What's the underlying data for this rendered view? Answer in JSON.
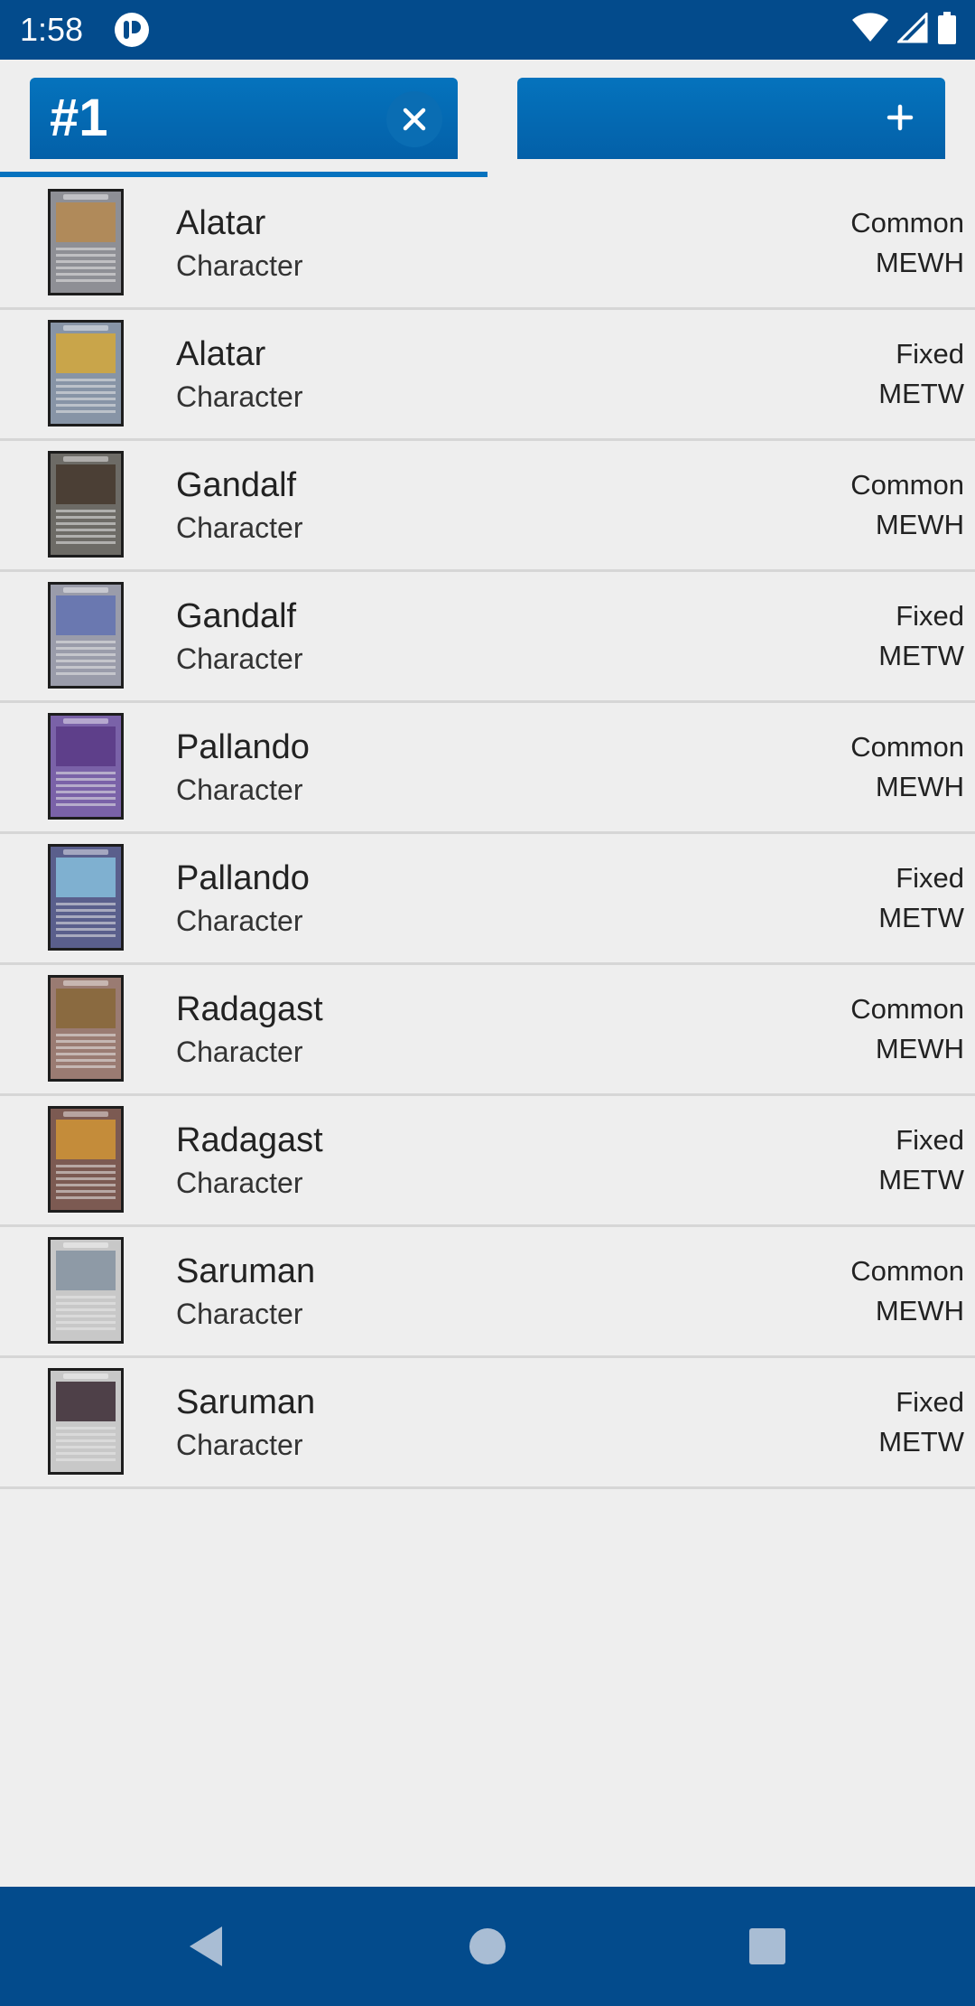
{
  "status_bar": {
    "time": "1:58",
    "icons": [
      "app-notification-icon",
      "wifi-icon",
      "cellular-signal-icon",
      "battery-icon"
    ]
  },
  "tabs": [
    {
      "label": "#1",
      "icon": "close-icon",
      "active": true
    },
    {
      "label": "",
      "icon": "plus-icon",
      "active": false
    }
  ],
  "cards": [
    {
      "name": "Alatar",
      "type": "Character",
      "rarity": "Common",
      "set": "MEWH",
      "art_color": "#b08a5a",
      "frame_color": "#8e8f95"
    },
    {
      "name": "Alatar",
      "type": "Character",
      "rarity": "Fixed",
      "set": "METW",
      "art_color": "#c9a54a",
      "frame_color": "#8794a6"
    },
    {
      "name": "Gandalf",
      "type": "Character",
      "rarity": "Common",
      "set": "MEWH",
      "art_color": "#4b3f35",
      "frame_color": "#6d6b66"
    },
    {
      "name": "Gandalf",
      "type": "Character",
      "rarity": "Fixed",
      "set": "METW",
      "art_color": "#6a78b0",
      "frame_color": "#9a9caa"
    },
    {
      "name": "Pallando",
      "type": "Character",
      "rarity": "Common",
      "set": "MEWH",
      "art_color": "#5e3f8a",
      "frame_color": "#7a62a8"
    },
    {
      "name": "Pallando",
      "type": "Character",
      "rarity": "Fixed",
      "set": "METW",
      "art_color": "#7fb0d0",
      "frame_color": "#5a5f8c"
    },
    {
      "name": "Radagast",
      "type": "Character",
      "rarity": "Common",
      "set": "MEWH",
      "art_color": "#8a6a40",
      "frame_color": "#9a7b72"
    },
    {
      "name": "Radagast",
      "type": "Character",
      "rarity": "Fixed",
      "set": "METW",
      "art_color": "#c48c3a",
      "frame_color": "#7c5a52"
    },
    {
      "name": "Saruman",
      "type": "Character",
      "rarity": "Common",
      "set": "MEWH",
      "art_color": "#8e9aa6",
      "frame_color": "#c8c8c8"
    },
    {
      "name": "Saruman",
      "type": "Character",
      "rarity": "Fixed",
      "set": "METW",
      "art_color": "#4e4048",
      "frame_color": "#c8c8c8"
    }
  ],
  "nav_bar": {
    "buttons": [
      "back-icon",
      "home-icon",
      "recents-icon"
    ]
  },
  "colors": {
    "primary": "#034b8c",
    "tab": "#0573bd",
    "background": "#eeeeee"
  }
}
